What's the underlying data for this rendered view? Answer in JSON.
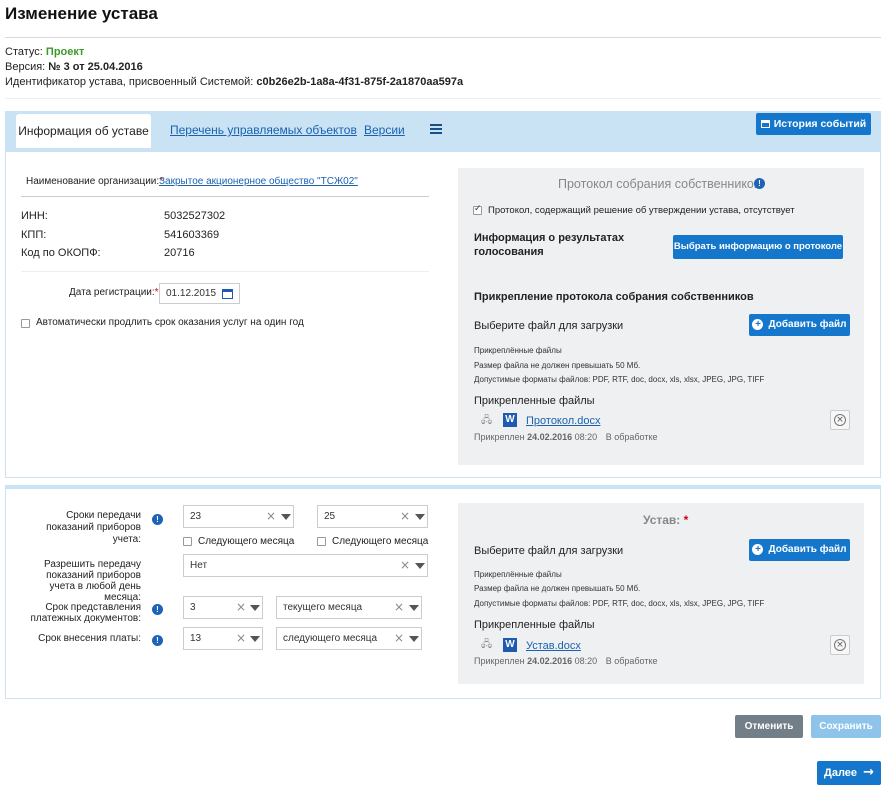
{
  "page": {
    "title": "Изменение устава"
  },
  "meta": {
    "status_label": "Статус:",
    "status_value": "Проект",
    "version_label": "Версия:",
    "version_value": "№ 3 от 25.04.2016",
    "id_label": "Идентификатор устава, присвоенный Системой:",
    "id_value": "c0b26e2b-1a8a-4f31-875f-2a1870aa597a"
  },
  "tabs": {
    "active": "Информация об уставе",
    "objects": "Перечень управляемых объектов",
    "versions": "Версии",
    "history_button": "История событий"
  },
  "org": {
    "name_label": "Наименование организации:",
    "name_value": "Закрытое акционерное общество \"ТСЖ02\"",
    "inn_label": "ИНН:",
    "inn_value": "5032527302",
    "kpp_label": "КПП:",
    "kpp_value": "541603369",
    "okopf_label": "Код по ОКОПФ:",
    "okopf_value": "20716",
    "reg_date_label": "Дата регистрации:",
    "reg_date_value": "01.12.2015",
    "auto_extend_label": "Автоматически продлить срок оказания услуг на один год"
  },
  "protocol": {
    "title": "Протокол собрания собственников",
    "absent_label": "Протокол, содержащий решение об утверждении устава, отсутствует",
    "vote_info_label": "Информация о результатах голосования",
    "select_info_button": "Выбрать информацию о протоколе",
    "attach_title": "Прикрепление протокола собрания собственников",
    "choose_file_label": "Выберите файл для загрузки",
    "add_file_button": "Добавить файл",
    "attached_hint": "Прикреплённые файлы",
    "size_hint": "Размер файла не должен превышать 50 Мб.",
    "formats_hint": "Допустимые форматы файлов: PDF, RTF, doc, docx, xls, xlsx, JPEG, JPG, TIFF",
    "attached_title": "Прикрепленные файлы",
    "file_name": "Протокол.docx",
    "attached_prefix": "Прикреплен",
    "attached_date": "24.02.2016",
    "attached_time": "08:20",
    "file_status": "В обработке"
  },
  "meters": {
    "transfer_label": "Сроки передачи показаний приборов учета:",
    "from_value": "23",
    "to_value": "25",
    "next_month_1": "Следующего месяца",
    "next_month_2": "Следующего месяца",
    "any_day_label": "Разрешить передачу показаний приборов учета в любой день месяца:",
    "any_day_value": "Нет",
    "payment_docs_label": "Срок представления платежных документов:",
    "payment_docs_day": "3",
    "payment_docs_month": "текущего месяца",
    "payment_label": "Срок внесения платы:",
    "payment_day": "13",
    "payment_month": "следующего месяца"
  },
  "charter": {
    "title": "Устав:",
    "choose_file_label": "Выберите файл для загрузки",
    "add_file_button": "Добавить файл",
    "attached_hint": "Прикреплённые файлы",
    "size_hint": "Размер файла не должен превышать 50 Мб.",
    "formats_hint": "Допустимые форматы файлов: PDF, RTF, doc, docx, xls, xlsx, JPEG, JPG, TIFF",
    "attached_title": "Прикрепленные файлы",
    "file_name": "Устав.docx",
    "attached_prefix": "Прикреплен",
    "attached_date": "24.02.2016",
    "attached_time": "08:20",
    "file_status": "В обработке"
  },
  "footer": {
    "cancel": "Отменить",
    "save": "Сохранить",
    "next": "Далее"
  },
  "colors": {
    "primary": "#1577cc",
    "tab_bar": "#c9e3f5",
    "status_green": "#3c9a28"
  }
}
